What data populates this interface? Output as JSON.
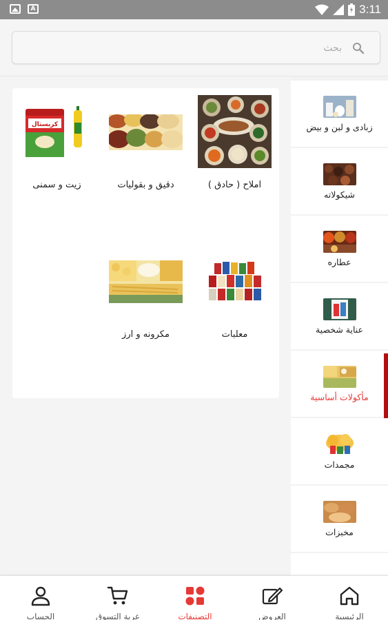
{
  "status_bar": {
    "time": "3:11"
  },
  "search": {
    "placeholder": "بحث"
  },
  "sidebar": {
    "active_color": "#e53935",
    "items": [
      {
        "label": "زبادى و لبن و بيض",
        "icon": "dairy-thumb"
      },
      {
        "label": "شيكولاته",
        "icon": "chocolate-thumb"
      },
      {
        "label": "عطاره",
        "icon": "spices-thumb"
      },
      {
        "label": "عناية شخصية",
        "icon": "personal-care-thumb"
      },
      {
        "label": "مأكولات أساسية",
        "icon": "staples-thumb",
        "active": true
      },
      {
        "label": "مجمدات",
        "icon": "frozen-thumb"
      },
      {
        "label": "مخبزات",
        "icon": "bakery-thumb"
      }
    ]
  },
  "content": {
    "tiles": [
      {
        "label": "املاح ( حادق )",
        "icon": "pickles-photo"
      },
      {
        "label": "دقيق و بقوليات",
        "icon": "legumes-photo"
      },
      {
        "label": "زيت و سمنى",
        "icon": "oil-ghee-photo"
      },
      {
        "label": "معلبات",
        "icon": "canned-photo"
      },
      {
        "label": "مكرونه و ارز",
        "icon": "pasta-rice-photo"
      }
    ]
  },
  "bottom_nav": {
    "items": [
      {
        "label": "الرئيسية",
        "icon": "home-icon"
      },
      {
        "label": "العروض",
        "icon": "offers-icon"
      },
      {
        "label": "التصنيفات",
        "icon": "categories-icon",
        "active": true
      },
      {
        "label": "عربة التسوق",
        "icon": "cart-icon"
      },
      {
        "label": "الحساب",
        "icon": "account-icon"
      }
    ]
  }
}
